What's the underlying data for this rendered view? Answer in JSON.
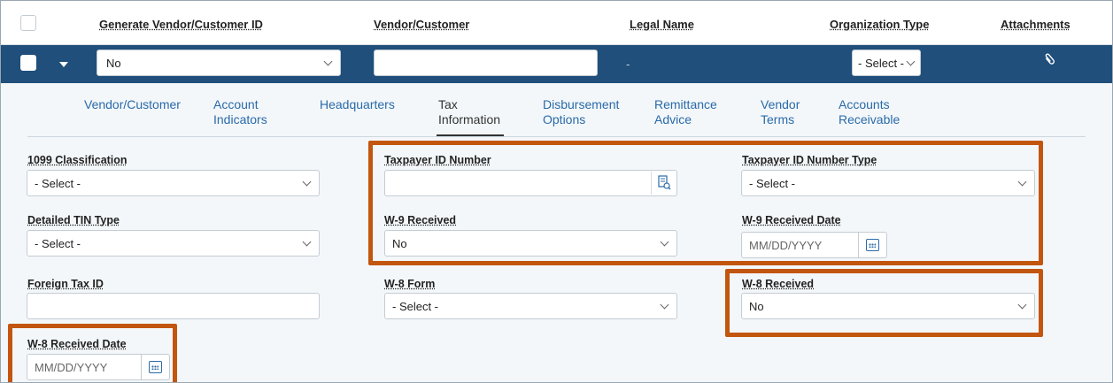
{
  "header": {
    "columns": [
      "Generate Vendor/Customer ID",
      "Vendor/Customer",
      "Legal Name",
      "Organization Type",
      "Attachments"
    ]
  },
  "row": {
    "generate_id_value": "No",
    "vendor_customer_value": "",
    "legal_name_value": "-",
    "org_type_value": "- Select -"
  },
  "tabs": [
    {
      "label": "Vendor/Customer"
    },
    {
      "label": "Account\nIndicators"
    },
    {
      "label": "Headquarters"
    },
    {
      "label": "Tax\nInformation"
    },
    {
      "label": "Disbursement\nOptions"
    },
    {
      "label": "Remittance\nAdvice"
    },
    {
      "label": "Vendor\nTerms"
    },
    {
      "label": "Accounts\nReceivable"
    }
  ],
  "form": {
    "classification_1099": {
      "label": "1099 Classification",
      "value": "- Select -"
    },
    "taxpayer_id": {
      "label": "Taxpayer ID Number",
      "value": ""
    },
    "taxpayer_id_type": {
      "label": "Taxpayer ID Number Type",
      "value": "- Select -"
    },
    "detailed_tin_type": {
      "label": "Detailed TIN Type",
      "value": "- Select -"
    },
    "w9_received": {
      "label": "W-9 Received",
      "value": "No"
    },
    "w9_received_date": {
      "label": "W-9 Received Date",
      "placeholder": "MM/DD/YYYY"
    },
    "foreign_tax_id": {
      "label": "Foreign Tax ID",
      "value": ""
    },
    "w8_form": {
      "label": "W-8 Form",
      "value": "- Select -"
    },
    "w8_received": {
      "label": "W-8 Received",
      "value": "No"
    },
    "w8_received_date": {
      "label": "W-8 Received Date",
      "placeholder": "MM/DD/YYYY"
    }
  },
  "colors": {
    "header_blue": "#1f4f7a",
    "tab_link": "#2a6aa8",
    "highlight": "#c2560f"
  }
}
